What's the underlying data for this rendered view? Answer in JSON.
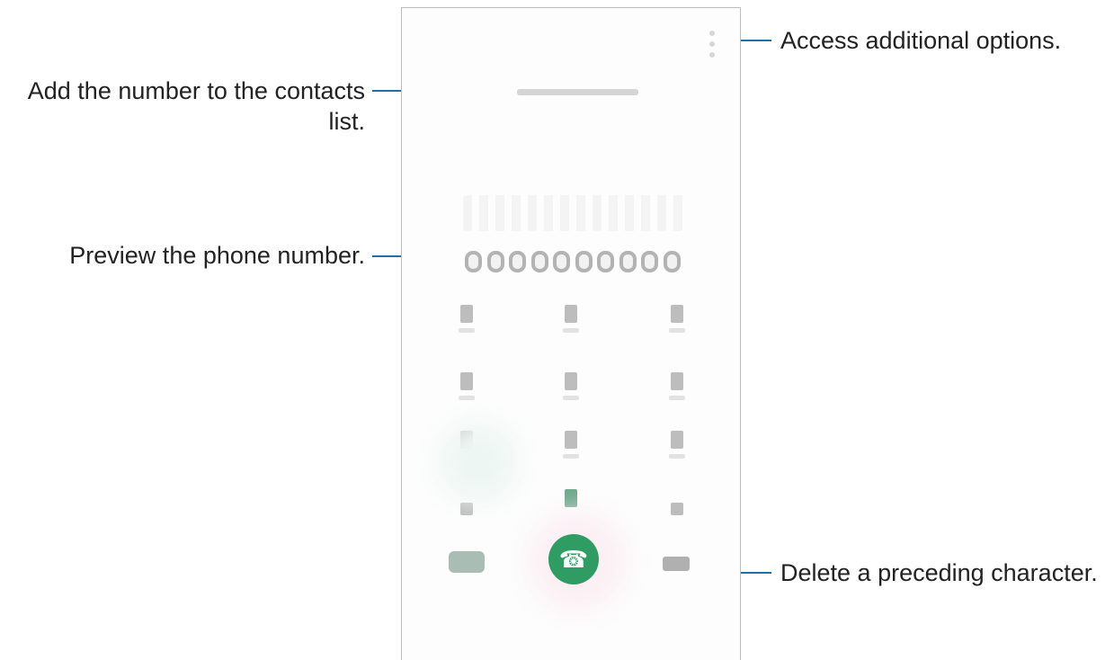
{
  "callouts": {
    "more_options": "Access additional options.",
    "add_contact_line1": "Add the number to the contacts",
    "add_contact_line2": "list.",
    "preview": "Preview the phone number.",
    "delete": "Delete a preceding character."
  },
  "icons": {
    "more": "more-options-icon",
    "add_contact": "add-contact-icon",
    "call": "phone-call-icon",
    "video": "video-call-icon",
    "backspace": "backspace-icon"
  },
  "colors": {
    "leader_line": "#1f6fa8",
    "call_button": "#2f9c63",
    "voicemail_accent": "#6fa88d"
  }
}
